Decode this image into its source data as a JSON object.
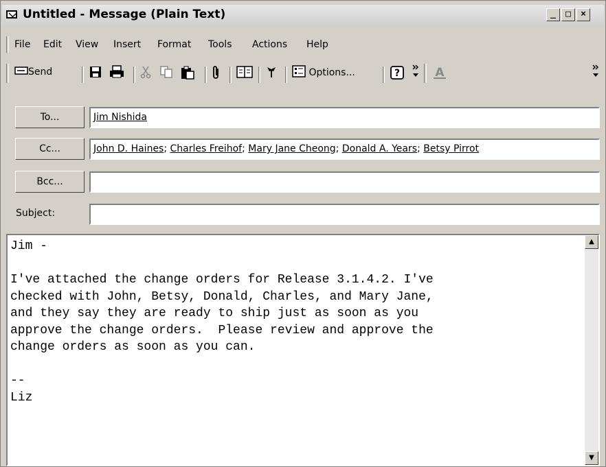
{
  "window": {
    "title": "Untitled - Message (Plain Text)",
    "controls": {
      "minimize": "_",
      "maximize": "□",
      "close": "×"
    }
  },
  "menu": {
    "items": [
      "File",
      "Edit",
      "View",
      "Insert",
      "Format",
      "Tools",
      "Actions",
      "Help"
    ]
  },
  "toolbar": {
    "send_label": "Send",
    "options_label": "Options...",
    "icons": [
      "send-icon",
      "save-icon",
      "print-icon",
      "cut-icon",
      "copy-icon",
      "paste-icon",
      "attach-icon",
      "address-book-icon",
      "flag-icon",
      "options-icon",
      "help-icon",
      "more-icon",
      "font-color-icon"
    ]
  },
  "header": {
    "to_label": "To...",
    "cc_label": "Cc...",
    "bcc_label": "Bcc...",
    "subject_label": "Subject:",
    "to": [
      "Jim Nishida"
    ],
    "cc": [
      "John D. Haines",
      "Charles Freihof",
      "Mary Jane Cheong",
      "Donald A. Years",
      "Betsy Pirrot"
    ],
    "bcc": "",
    "subject": ""
  },
  "body": {
    "text": "Jim -\n\nI've attached the change orders for Release 3.1.4.2. I've\nchecked with John, Betsy, Donald, Charles, and Mary Jane,\nand they say they are ready to ship just as soon as you\napprove the change orders.  Please review and approve the\nchange orders as soon as you can.\n\n--\nLiz"
  },
  "colors": {
    "chrome": "#d4d0c8",
    "field_bg": "#ffffff"
  }
}
